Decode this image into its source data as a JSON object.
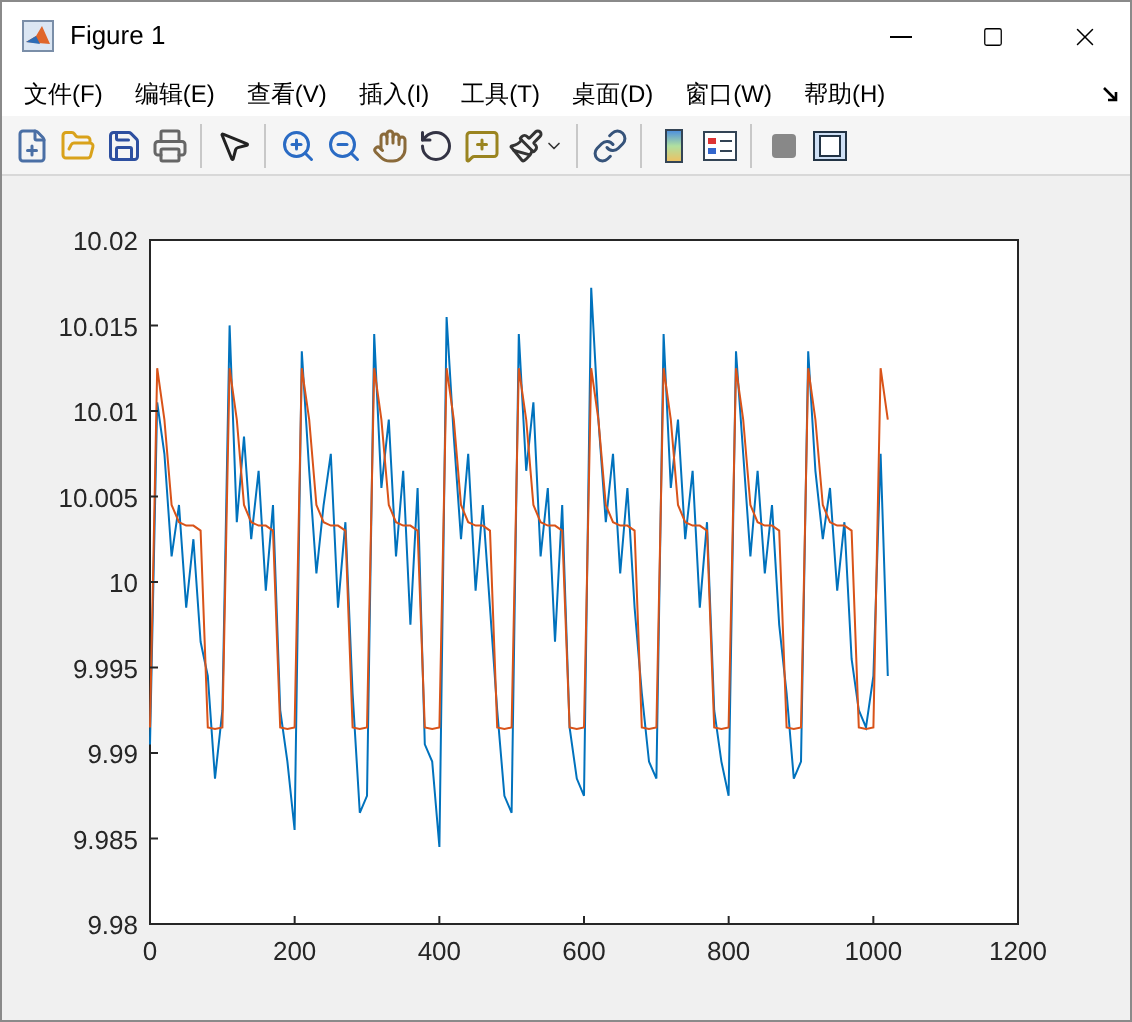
{
  "window": {
    "title": "Figure 1"
  },
  "menu": [
    "文件(F)",
    "编辑(E)",
    "查看(V)",
    "插入(I)",
    "工具(T)",
    "桌面(D)",
    "窗口(W)",
    "帮助(H)"
  ],
  "toolbar": [
    {
      "kind": "new"
    },
    {
      "kind": "open"
    },
    {
      "kind": "save"
    },
    {
      "kind": "print"
    },
    {
      "kind": "sep"
    },
    {
      "kind": "pointer"
    },
    {
      "kind": "sep"
    },
    {
      "kind": "zoom-in"
    },
    {
      "kind": "zoom-out"
    },
    {
      "kind": "pan"
    },
    {
      "kind": "rotate"
    },
    {
      "kind": "cursor"
    },
    {
      "kind": "brush"
    },
    {
      "kind": "sep"
    },
    {
      "kind": "link"
    },
    {
      "kind": "sep"
    },
    {
      "kind": "colorbar"
    },
    {
      "kind": "legend"
    },
    {
      "kind": "sep"
    },
    {
      "kind": "hide"
    },
    {
      "kind": "show"
    }
  ],
  "plot": {
    "chart_data": {
      "type": "line",
      "x": [
        0,
        10,
        20,
        30,
        40,
        50,
        60,
        70,
        80,
        90,
        100,
        110,
        120,
        130,
        140,
        150,
        160,
        170,
        180,
        190,
        200,
        210,
        220,
        230,
        240,
        250,
        260,
        270,
        280,
        290,
        300,
        310,
        320,
        330,
        340,
        350,
        360,
        370,
        380,
        390,
        400,
        410,
        420,
        430,
        440,
        450,
        460,
        470,
        480,
        490,
        500,
        510,
        520,
        530,
        540,
        550,
        560,
        570,
        580,
        590,
        600,
        610,
        620,
        630,
        640,
        650,
        660,
        670,
        680,
        690,
        700,
        710,
        720,
        730,
        740,
        750,
        760,
        770,
        780,
        790,
        800,
        810,
        820,
        830,
        840,
        850,
        860,
        870,
        880,
        890,
        900,
        910,
        920,
        930,
        940,
        950,
        960,
        970,
        980,
        990,
        1000,
        1010,
        1020
      ],
      "series": [
        {
          "color": "#0072bd",
          "values": [
            9.9905,
            10.0105,
            10.0075,
            10.0015,
            10.0045,
            9.9985,
            10.0025,
            9.9965,
            9.9945,
            9.9885,
            9.9925,
            10.015,
            10.0035,
            10.0085,
            10.0025,
            10.0065,
            9.9995,
            10.0045,
            9.9925,
            9.9895,
            9.9855,
            10.0135,
            10.0065,
            10.0005,
            10.0045,
            10.0075,
            9.9985,
            10.0035,
            9.9935,
            9.9865,
            9.9875,
            10.0145,
            10.0055,
            10.0095,
            10.0015,
            10.0065,
            9.9975,
            10.0055,
            9.9905,
            9.9895,
            9.9845,
            10.0155,
            10.0085,
            10.0025,
            10.0075,
            9.9995,
            10.0045,
            9.9985,
            9.9925,
            9.9875,
            9.9865,
            10.0145,
            10.0065,
            10.0105,
            10.0015,
            10.0055,
            9.9965,
            10.0045,
            9.9915,
            9.9885,
            9.9875,
            10.0172,
            10.0095,
            10.0035,
            10.0075,
            10.0005,
            10.0055,
            9.9985,
            9.9935,
            9.9895,
            9.9885,
            10.0145,
            10.0055,
            10.0095,
            10.0025,
            10.0065,
            9.9985,
            10.0035,
            9.9925,
            9.9895,
            9.9875,
            10.0135,
            10.0075,
            10.0015,
            10.0065,
            10.0005,
            10.0045,
            9.9975,
            9.9935,
            9.9885,
            9.9895,
            10.0135,
            10.0065,
            10.0025,
            10.0055,
            9.9995,
            10.0035,
            9.9955,
            9.9925,
            9.9915,
            9.9945,
            10.0075,
            9.9945
          ]
        },
        {
          "color": "#d95319",
          "values": [
            9.9915,
            10.0125,
            10.0095,
            10.0045,
            10.0035,
            10.0033,
            10.0033,
            10.003,
            9.9915,
            9.9914,
            9.9915,
            10.0125,
            10.0095,
            10.0045,
            10.0035,
            10.0033,
            10.0033,
            10.003,
            9.9915,
            9.9914,
            9.9915,
            10.0125,
            10.0095,
            10.0045,
            10.0035,
            10.0033,
            10.0033,
            10.003,
            9.9915,
            9.9914,
            9.9915,
            10.0125,
            10.0095,
            10.0045,
            10.0035,
            10.0033,
            10.0033,
            10.003,
            9.9915,
            9.9914,
            9.9915,
            10.0125,
            10.0095,
            10.0045,
            10.0035,
            10.0033,
            10.0033,
            10.003,
            9.9915,
            9.9914,
            9.9915,
            10.0125,
            10.0095,
            10.0045,
            10.0035,
            10.0033,
            10.0033,
            10.003,
            9.9915,
            9.9914,
            9.9915,
            10.0125,
            10.0095,
            10.0045,
            10.0035,
            10.0033,
            10.0033,
            10.003,
            9.9915,
            9.9914,
            9.9915,
            10.0125,
            10.0095,
            10.0045,
            10.0035,
            10.0033,
            10.0033,
            10.003,
            9.9915,
            9.9914,
            9.9915,
            10.0125,
            10.0095,
            10.0045,
            10.0035,
            10.0033,
            10.0033,
            10.003,
            9.9915,
            9.9914,
            9.9915,
            10.0125,
            10.0095,
            10.0045,
            10.0035,
            10.0033,
            10.0033,
            10.003,
            9.9915,
            9.9914,
            9.9915,
            10.0125,
            10.0095
          ]
        }
      ],
      "xlim": [
        0,
        1200
      ],
      "ylim": [
        9.98,
        10.02
      ],
      "xticks": [
        0,
        200,
        400,
        600,
        800,
        1000,
        1200
      ],
      "yticks": [
        9.98,
        9.985,
        9.99,
        9.995,
        10,
        10.005,
        10.01,
        10.015,
        10.02
      ]
    }
  }
}
